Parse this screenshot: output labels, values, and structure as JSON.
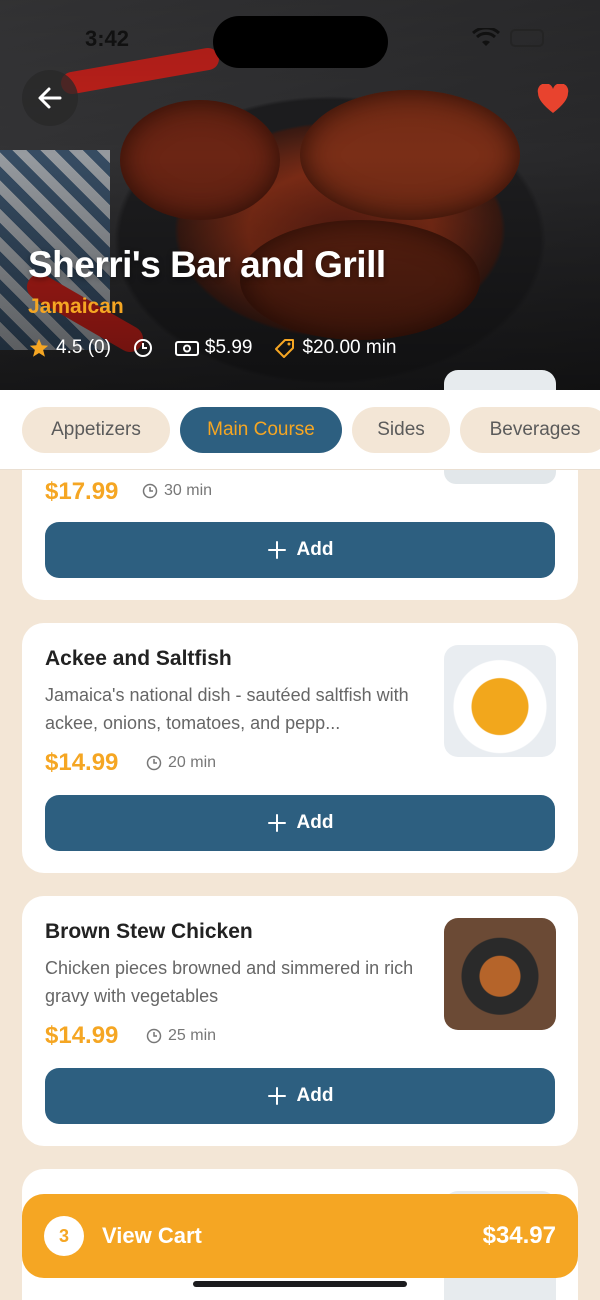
{
  "status_bar": {
    "time": "3:42"
  },
  "restaurant": {
    "name": "Sherri's Bar and Grill",
    "cuisine": "Jamaican",
    "rating": "4.5 (0)",
    "delivery_fee": "$5.99",
    "minimum": "$20.00 min"
  },
  "tabs": [
    {
      "label": "Appetizers",
      "active": false
    },
    {
      "label": "Main Course",
      "active": true
    },
    {
      "label": "Sides",
      "active": false
    },
    {
      "label": "Beverages",
      "active": false
    }
  ],
  "items": [
    {
      "title": "",
      "description": "",
      "price": "$17.99",
      "time": "30 min",
      "add_label": "Add"
    },
    {
      "title": "Ackee and Saltfish",
      "description": "Jamaica's national dish - sautéed saltfish with ackee, onions, tomatoes, and pepp...",
      "price": "$14.99",
      "time": "20 min",
      "add_label": "Add"
    },
    {
      "title": "Brown Stew Chicken",
      "description": "Chicken pieces browned and simmered in rich gravy with vegetables",
      "price": "$14.99",
      "time": "25 min",
      "add_label": "Add"
    }
  ],
  "cart": {
    "count": "3",
    "label": "View Cart",
    "total": "$34.97"
  },
  "colors": {
    "accent": "#f5a623",
    "primary": "#2d5f80",
    "background": "#f3e6d6"
  }
}
